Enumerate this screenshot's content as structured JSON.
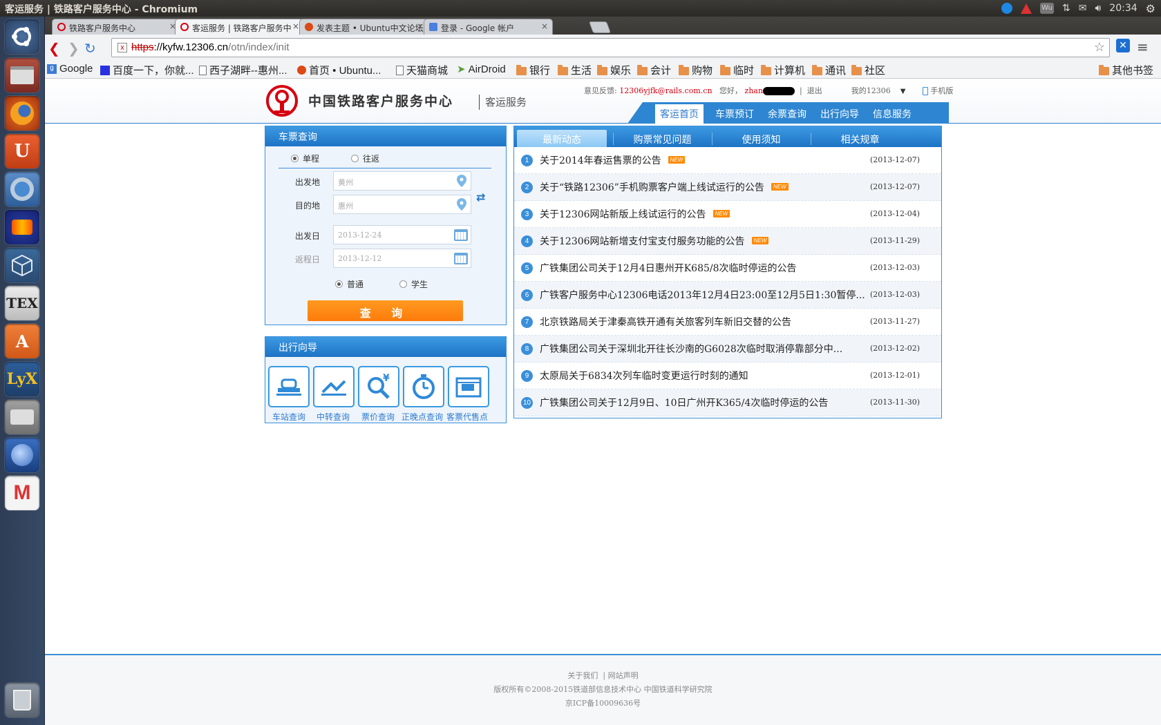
{
  "window": {
    "title": "客运服务 | 铁路客户服务中心 - Chromium"
  },
  "system_tray": {
    "clock": "20:34",
    "icons": [
      "skype-icon",
      "warning-icon",
      "wu-icon",
      "network-icon",
      "mail-icon",
      "volume-icon",
      "settings-gear-icon"
    ]
  },
  "launcher": {
    "apps": [
      "ubuntu-dash-icon",
      "file-manager-icon",
      "firefox-icon",
      "ubuntu-one-icon",
      "chromium-icon",
      "audacity-icon",
      "virtualbox-icon",
      "texmaker-icon",
      "software-center-icon",
      "lyx-icon",
      "scanner-icon",
      "thunderbird-icon",
      "gmail-icon",
      "trash-icon"
    ],
    "tex_label": "TEX"
  },
  "tabs": [
    {
      "label": "铁路客户服务中心",
      "active": false,
      "color": "#d6000f"
    },
    {
      "label": "客运服务 | 铁路客户服务中",
      "active": true,
      "color": "#d6000f"
    },
    {
      "label": "发表主题 • Ubuntu中文论坛",
      "active": false,
      "color": "#dd4814"
    },
    {
      "label": "登录 - Google 帐户",
      "active": false,
      "color": "#4a7fe0"
    }
  ],
  "tab_close": "×",
  "omnibox": {
    "scheme": "https",
    "host": "://kyfw.12306.cn",
    "path": "/otn/index/init"
  },
  "bookmarks": {
    "items": [
      "Google",
      "百度一下，你就...",
      "西子湖畔--惠州...",
      "首页 • Ubuntu...",
      "天猫商城",
      "AirDroid",
      "银行",
      "生活",
      "娱乐",
      "会计",
      "购物",
      "临时",
      "计算机",
      "通讯",
      "社区"
    ],
    "other": "其他书签"
  },
  "header": {
    "brand": "中国铁路客户服务中心",
    "brand_sub": "客运服务",
    "feedback_label": "意见反馈:",
    "feedback_email": "12306yjfk@rails.com.cn",
    "greeting": "您好，",
    "username": "zhan",
    "logout": "退出",
    "my12306": "我的12306",
    "mobile": "手机版",
    "nav": [
      "客运首页",
      "车票预订",
      "余票查询",
      "出行向导",
      "信息服务"
    ]
  },
  "ticket_query": {
    "title": "车票查询",
    "trip_types": [
      "单程",
      "往返"
    ],
    "from_label": "出发地",
    "from_value": "黄州",
    "to_label": "目的地",
    "to_value": "惠州",
    "depart_label": "出发日",
    "depart_value": "2013-12-24",
    "return_label": "返程日",
    "return_value": "2013-12-12",
    "passenger_types": [
      "普通",
      "学生"
    ],
    "submit": "查 询"
  },
  "travel_guide": {
    "title": "出行向导",
    "items": [
      "车站查询",
      "中转查询",
      "票价查询",
      "正晚点查询",
      "客票代售点"
    ]
  },
  "news": {
    "tabs": [
      "最新动态",
      "购票常见问题",
      "使用须知",
      "相关规章"
    ],
    "badge": "NEW",
    "items": [
      {
        "num": "1",
        "title": "关于2014年春运售票的公告",
        "date": "(2013-12-07)",
        "new": true
      },
      {
        "num": "2",
        "title": "关于“铁路12306”手机购票客户端上线试运行的公告",
        "date": "(2013-12-07)",
        "new": true
      },
      {
        "num": "3",
        "title": "关于12306网站新版上线试运行的公告",
        "date": "(2013-12-04)",
        "new": true
      },
      {
        "num": "4",
        "title": "关于12306网站新增支付宝支付服务功能的公告",
        "date": "(2013-11-29)",
        "new": true
      },
      {
        "num": "5",
        "title": "广铁集团公司关于12月4日惠州开K685/8次临时停运的公告",
        "date": "(2013-12-03)",
        "new": false
      },
      {
        "num": "6",
        "title": "广铁客户服务中心12306电话2013年12月4日23:00至12月5日1:30暂停...",
        "date": "(2013-12-03)",
        "new": false
      },
      {
        "num": "7",
        "title": "北京铁路局关于津秦高铁开通有关旅客列车新旧交替的公告",
        "date": "(2013-11-27)",
        "new": false
      },
      {
        "num": "8",
        "title": "广铁集团公司关于深圳北开往长沙南的G6028次临时取消停靠部分中...",
        "date": "(2013-12-02)",
        "new": false
      },
      {
        "num": "9",
        "title": "太原局关于6834次列车临时变更运行时刻的通知",
        "date": "(2013-12-01)",
        "new": false
      },
      {
        "num": "10",
        "title": "广铁集团公司关于12月9日、10日广州开K365/4次临时停运的公告",
        "date": "(2013-11-30)",
        "new": false
      }
    ]
  },
  "footer": {
    "about": "关于我们",
    "statement": "网站声明",
    "copyright": "版权所有©2008-2015铁道部信息技术中心  中国铁道科学研究院",
    "icp": "京ICP备10009636号"
  },
  "colors": {
    "accent": "#2e86d2",
    "brand_red": "#d6000f",
    "button_orange": "#fd7b0b"
  }
}
